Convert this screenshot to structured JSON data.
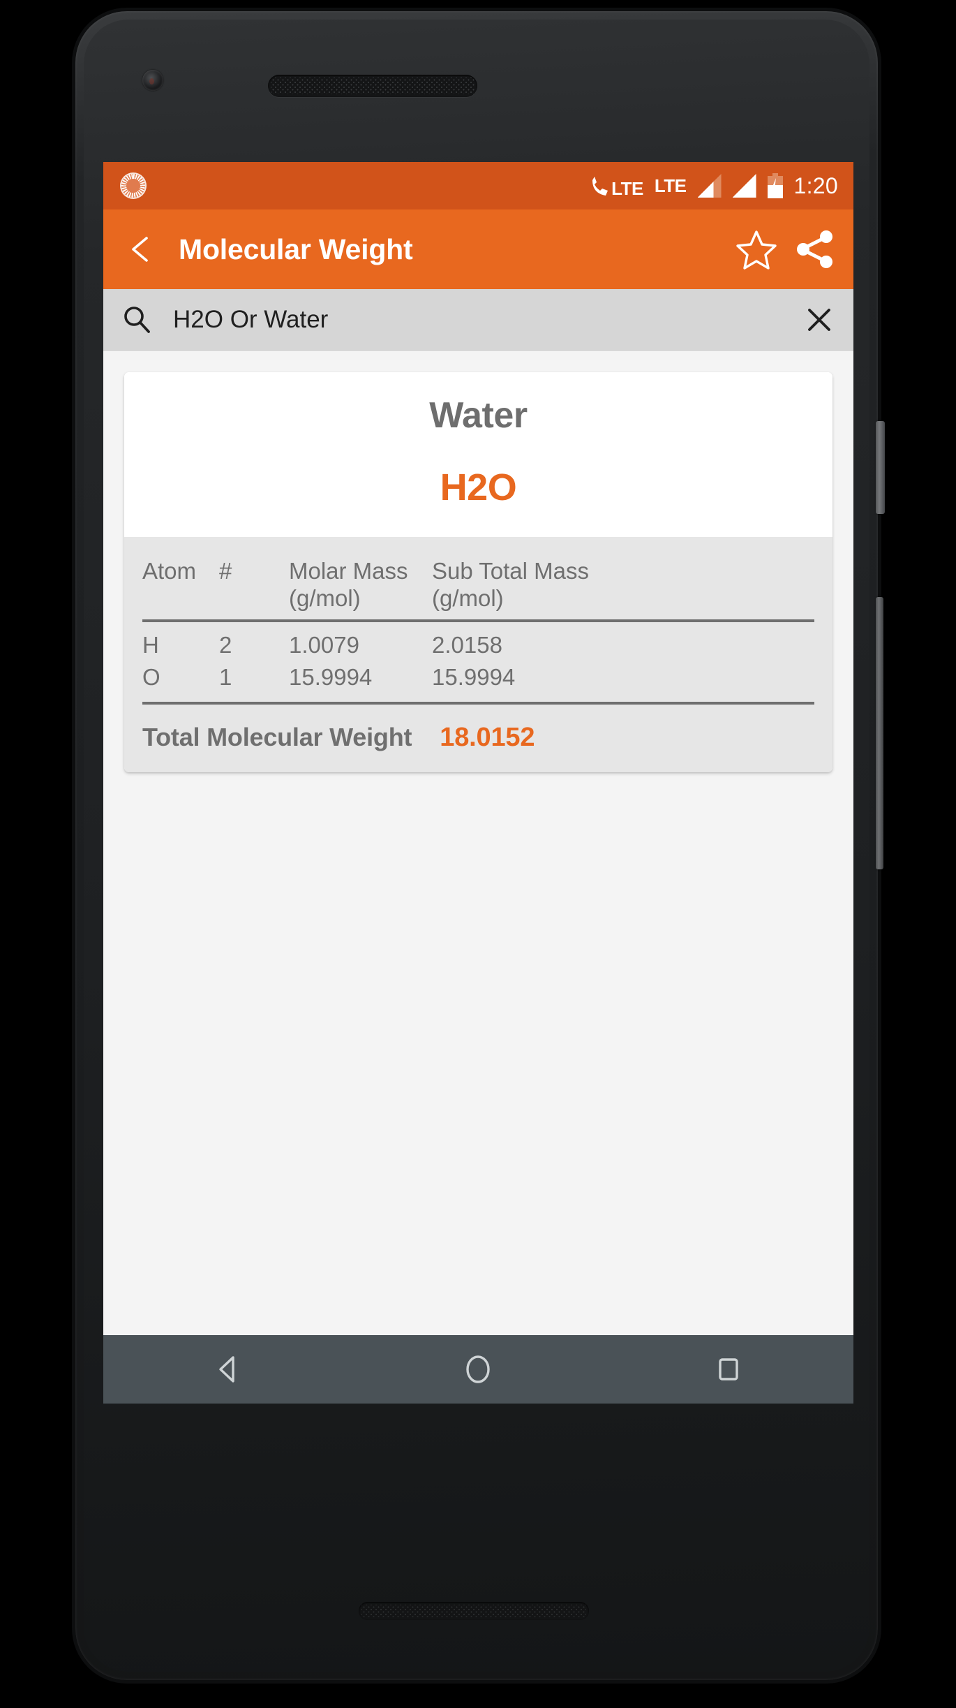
{
  "status_bar": {
    "notification_icon": "sun-sync-icon",
    "carrier_label_1": "LTE",
    "carrier_label_2": "LTE",
    "signal_icons": [
      "signal-bars-partial-icon",
      "signal-bars-full-icon"
    ],
    "battery_icon": "battery-charging-icon",
    "time": "1:20",
    "background_color": "#d1531a"
  },
  "app_bar": {
    "back_icon": "back-arrow-icon",
    "title": "Molecular Weight",
    "favorite_icon": "star-outline-icon",
    "share_icon": "share-icon",
    "background_color": "#e8681f"
  },
  "search": {
    "icon": "search-icon",
    "value": "H2O Or Water",
    "placeholder": "Search",
    "clear_icon": "close-x-icon",
    "background_color": "#d6d6d6"
  },
  "result_card": {
    "compound_name": "Water",
    "formula": "H2O",
    "formula_color": "#e8681f",
    "table": {
      "headers": [
        "Atom",
        "#",
        "Molar Mass\n(g/mol)",
        "Sub Total Mass\n(g/mol)"
      ],
      "header_atom": "Atom",
      "header_count": "#",
      "header_molar_line1": "Molar Mass",
      "header_molar_line2": "(g/mol)",
      "header_sub_line1": "Sub Total Mass",
      "header_sub_line2": "(g/mol)",
      "rows": [
        {
          "atom": "H",
          "count": "2",
          "molar_mass": "1.0079",
          "sub_total": "2.0158"
        },
        {
          "atom": "O",
          "count": "1",
          "molar_mass": "15.9994",
          "sub_total": "15.9994"
        }
      ]
    },
    "total_label": "Total Molecular Weight",
    "total_value": "18.0152",
    "total_value_color": "#e8681f"
  },
  "nav_bar": {
    "back_icon": "nav-back-triangle-icon",
    "home_icon": "nav-home-circle-icon",
    "recents_icon": "nav-recents-square-icon",
    "background_color": "#4a5257"
  }
}
